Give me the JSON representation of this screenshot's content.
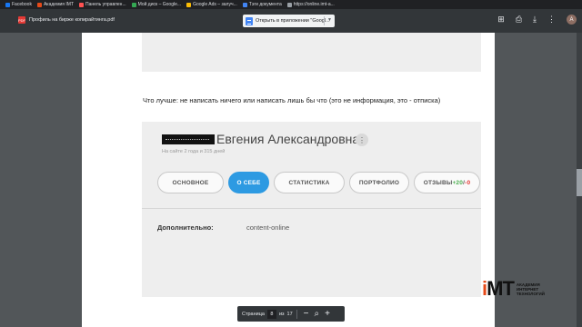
{
  "bookmarks": [
    {
      "label": "Facebook",
      "color": "#1877f2"
    },
    {
      "label": "Академия IMT",
      "color": "#e64a19"
    },
    {
      "label": "Панель управлен...",
      "color": "#ff5252"
    },
    {
      "label": "Мой диск – Google...",
      "color": "#34a853"
    },
    {
      "label": "Google Ads – залуч...",
      "color": "#fbbc04"
    },
    {
      "label": "Тэги документа",
      "color": "#4285f4"
    },
    {
      "label": "https://online.imt-a...",
      "color": "#9aa0a6"
    }
  ],
  "toolbar": {
    "pdf_badge": "PDF",
    "title": "Профиль на бирже копирайтинга.pdf",
    "open_with": "Открыть в приложении \"Googl...",
    "avatar_letter": "A",
    "icons": [
      "add-to-drive-icon",
      "print-icon",
      "download-icon",
      "more-vert-icon"
    ]
  },
  "document": {
    "question": "Что лучше: не написать ничего или написать лишь бы что (это не информация, это - отписка)",
    "profile": {
      "name": "Евгения Александровна",
      "since": "На сайте 2 года и 315 дней",
      "tabs": [
        "ОСНОВНОЕ",
        "О СЕБЕ",
        "СТАТИСТИКА",
        "ПОРТФОЛИО"
      ],
      "reviews": {
        "label": "ОТЗЫВЫ ",
        "positive": "+20",
        "sep": "/",
        "negative": "-0"
      },
      "active_tab": "О СЕБЕ",
      "extra_label": "Дополнительно:",
      "extra_value": "content-online"
    }
  },
  "pager": {
    "label": "Страница",
    "current": "8",
    "of": "из",
    "total": "17",
    "minus": "−",
    "plus": "+"
  },
  "logo": {
    "mark_left": "i",
    "mark_right": "MT",
    "line1": "АКАДЕМИЯ",
    "line2": "ИНТЕРНЕТ",
    "line3": "ТЕХНОЛОГИЙ"
  }
}
